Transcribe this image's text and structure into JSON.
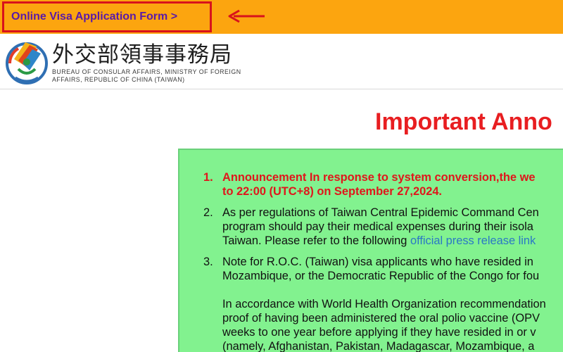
{
  "top_bar": {
    "form_link_label": "Online Visa Application Form >"
  },
  "header": {
    "agency_name_zh": "外交部領事事務局",
    "agency_name_en_line1": "BUREAU OF CONSULAR AFFAIRS, MINISTRY OF FOREIGN",
    "agency_name_en_line2": "AFFAIRS, REPUBLIC OF CHINA (TAIWAN)"
  },
  "main": {
    "title": "Important Anno",
    "items": [
      {
        "number": "1.",
        "lines": [
          "Announcement In response to system conversion,the we",
          "to 22:00 (UTC+8) on September 27,2024."
        ]
      },
      {
        "number": "2.",
        "lines": [
          "As per regulations of Taiwan Central Epidemic Command Cen",
          "program should pay their medical expenses during their isola",
          "Taiwan. Please refer to the following "
        ],
        "link_text": "official press release link"
      },
      {
        "number": "3.",
        "lines": [
          "Note for R.O.C. (Taiwan) visa applicants who have resided in",
          "Mozambique, or the Democratic Republic of the Congo for fou"
        ],
        "para_lines": [
          "In accordance with World Health Organization recommendation",
          "proof of having been administered the oral polio vaccine (OPV",
          "weeks to one year before applying if they have resided in or v",
          "(namely, Afghanistan, Pakistan, Madagascar, Mozambique, a"
        ]
      }
    ]
  },
  "colors": {
    "top_bar": "#fca50f",
    "highlight_border": "#d8121c",
    "link_purple": "#5a1aa8",
    "title_red": "#e81e21",
    "box_green": "#82f28f",
    "link_blue": "#2a78c6"
  },
  "icons": {
    "arrow": "left-arrow-icon",
    "logo": "boca-logo-icon"
  }
}
